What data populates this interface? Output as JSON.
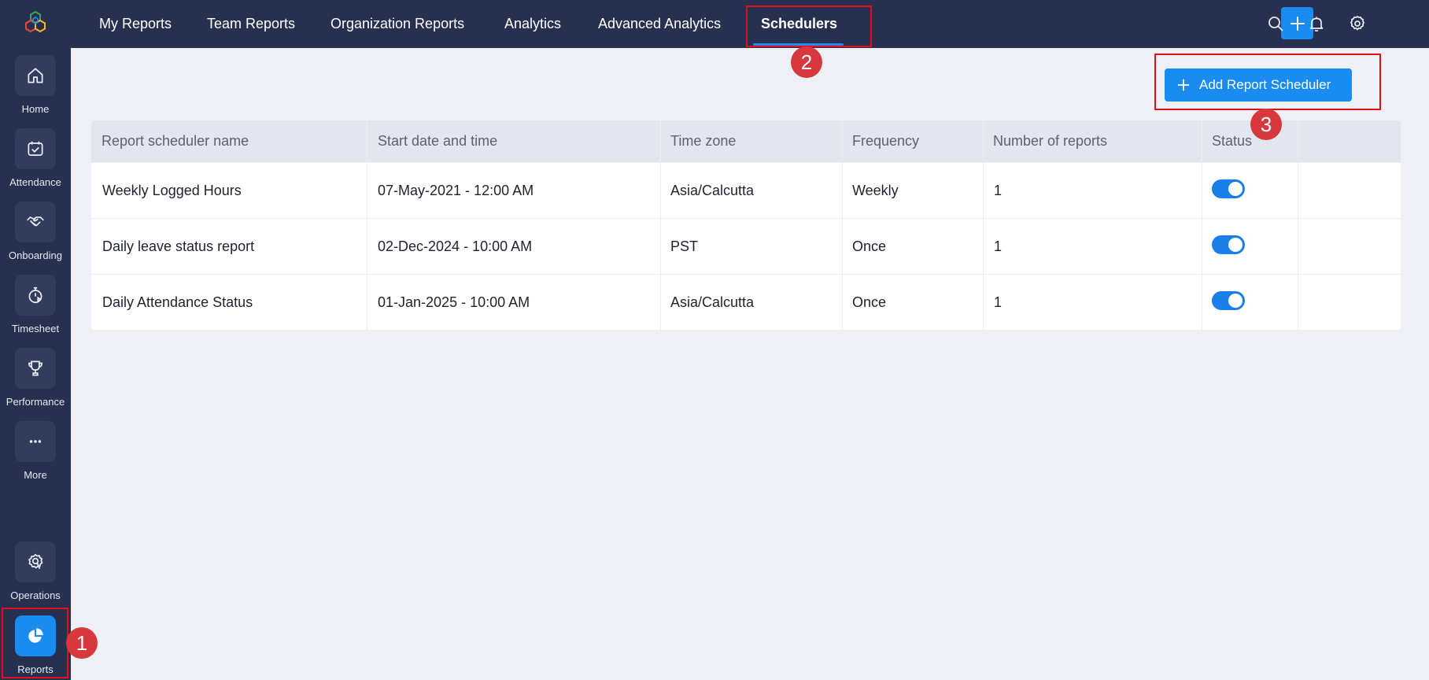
{
  "sidebar": {
    "items": [
      {
        "label": "Home",
        "icon": "home-icon"
      },
      {
        "label": "Attendance",
        "icon": "calendar-check-icon"
      },
      {
        "label": "Onboarding",
        "icon": "handshake-icon"
      },
      {
        "label": "Timesheet",
        "icon": "stopwatch-icon"
      },
      {
        "label": "Performance",
        "icon": "trophy-icon"
      },
      {
        "label": "More",
        "icon": "more-dots-icon"
      },
      {
        "label": "Operations",
        "icon": "operations-icon"
      },
      {
        "label": "Reports",
        "icon": "pie-chart-icon",
        "active": true
      }
    ]
  },
  "topnav": {
    "tabs": [
      {
        "label": "My Reports"
      },
      {
        "label": "Team Reports"
      },
      {
        "label": "Organization Reports"
      },
      {
        "label": "Analytics"
      },
      {
        "label": "Advanced Analytics"
      },
      {
        "label": "Schedulers",
        "active": true
      }
    ]
  },
  "actions": {
    "add_scheduler_label": "Add Report Scheduler"
  },
  "table": {
    "headers": [
      "Report scheduler name",
      "Start date and time",
      "Time zone",
      "Frequency",
      "Number of reports",
      "Status"
    ],
    "rows": [
      {
        "name": "Weekly Logged Hours",
        "start": "07-May-2021 - 12:00 AM",
        "timezone": "Asia/Calcutta",
        "frequency": "Weekly",
        "count": "1",
        "status_on": true
      },
      {
        "name": "Daily leave status report",
        "start": "02-Dec-2024 - 10:00 AM",
        "timezone": "PST",
        "frequency": "Once",
        "count": "1",
        "status_on": true
      },
      {
        "name": "Daily Attendance Status",
        "start": "01-Jan-2025 - 10:00 AM",
        "timezone": "Asia/Calcutta",
        "frequency": "Once",
        "count": "1",
        "status_on": true
      }
    ]
  },
  "annotations": [
    "1",
    "2",
    "3"
  ],
  "colors": {
    "nav_bg": "#27314f",
    "accent": "#1a8cf1",
    "highlight": "#e0101a",
    "badge": "#d6383d"
  }
}
